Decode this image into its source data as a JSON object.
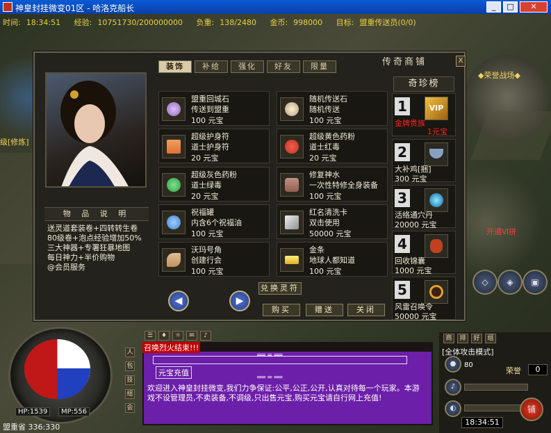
{
  "window": {
    "title": "神皇封挂微变01区 - 哈洛克船长",
    "min": "_",
    "max": "□",
    "close": "✕"
  },
  "status_line": {
    "time_label": "时间:",
    "time": "18:34:51",
    "exp_label": "经验:",
    "exp": "10751730/200000000",
    "weight_label": "负重:",
    "weight": "138/2480",
    "gold_label": "金币:",
    "gold": "998000",
    "target_label": "目标:",
    "target": "盟重传送员(0/0)"
  },
  "world_labels": {
    "right_guild": "◆荣誉战场◆",
    "left_npc": "级[修炼]",
    "right_npc": "开通Ⅵ拼"
  },
  "shop": {
    "title": "传奇商铺",
    "close": "X",
    "tabs": [
      {
        "label": "装饰",
        "active": true
      },
      {
        "label": "补给",
        "active": false
      },
      {
        "label": "强化",
        "active": false
      },
      {
        "label": "好友",
        "active": false
      },
      {
        "label": "限量",
        "active": false
      }
    ],
    "items": [
      {
        "name": "盟重回城石",
        "desc": "传送到盟重",
        "price": "100 元宝",
        "icon": "stone-icon",
        "color": "#8a6ab0"
      },
      {
        "name": "随机传送石",
        "desc": "随机传送",
        "price": "100 元宝",
        "icon": "stone-icon",
        "color": "#b0a080"
      },
      {
        "name": "超级护身符",
        "desc": "道士护身符",
        "price": "20 元宝",
        "icon": "talisman-icon",
        "color": "#e07030"
      },
      {
        "name": "超级黄色药粉",
        "desc": "道士红毒",
        "price": "20 元宝",
        "icon": "powder-bag-icon",
        "color": "#c03020"
      },
      {
        "name": "超级灰色药粉",
        "desc": "道士绿毒",
        "price": "20 元宝",
        "icon": "powder-bag-icon",
        "color": "#30a040"
      },
      {
        "name": "修复神水",
        "desc": "一次性特修全身装备",
        "price": "100 元宝",
        "icon": "potion-icon",
        "color": "#906050"
      },
      {
        "name": "祝福罐",
        "desc": "内含6个祝福油",
        "price": "100 元宝",
        "icon": "jar-icon",
        "color": "#4080d0"
      },
      {
        "name": "红名清洗卡",
        "desc": "双击使用",
        "price": "50000 元宝",
        "icon": "card-icon",
        "color": "#c0c0c0"
      },
      {
        "name": "沃玛号角",
        "desc": "创建行会",
        "price": "100 元宝",
        "icon": "horn-icon",
        "color": "#c09060"
      },
      {
        "name": "金条",
        "desc": "地球人都知道",
        "price": "100 元宝",
        "icon": "gold-bar-icon",
        "color": "#e0b020"
      }
    ],
    "description_title": "物 品 说 明",
    "description_lines": [
      "送灵道套装卷+四转转生卷",
      "80级卷+泡点经验增加50%",
      "三大神器+专署狂暴地图",
      "每日神力+半价购物",
      "@会员服务"
    ],
    "rank_title": "奇珍榜",
    "ranks": [
      {
        "num": "1",
        "name": "金牌贵族",
        "price": "1元宝",
        "icon": "vip-icon",
        "name_color": "#ff2020"
      },
      {
        "num": "2",
        "name": "大补鸡[捆]",
        "price": "300 元宝",
        "icon": "bowl-icon",
        "name_color": "#f0ead8"
      },
      {
        "num": "3",
        "name": "活络通穴丹",
        "price": "20000 元宝",
        "icon": "pill-icon",
        "name_color": "#f0ead8"
      },
      {
        "name": "回收锦囊",
        "num": "4",
        "price": "1000 元宝",
        "icon": "pouch-icon",
        "name_color": "#f0ead8"
      },
      {
        "num": "5",
        "name": "风雷召唤令",
        "price": "50000 元宝",
        "icon": "token-icon",
        "name_color": "#f0ead8"
      }
    ],
    "buttons": {
      "exchange": "兑换灵符",
      "buy": "购买",
      "gift": "赠送",
      "close": "关闭"
    }
  },
  "hud": {
    "hp": "HP:1539",
    "mp": "MP:556",
    "location": "盟重省 336:330",
    "attack_mode": "[全体攻击模式]",
    "level": "80",
    "honor_label": "荣誉",
    "honor_value": "0",
    "clock": "18:34:51",
    "shop_button": "铺",
    "chat_alert": "召唤烈火结束!!!",
    "chat_label": "元宝充值",
    "chat_message": "欢迎进入神皇封挂微变,我们力争保证:公平,公正,公开,认真对待每一个玩家。本游戏不设管理员,不卖装备,不调级,只出售元宝,购买元宝请自行网上充值!",
    "chat_eq": "══ ═ ══"
  }
}
